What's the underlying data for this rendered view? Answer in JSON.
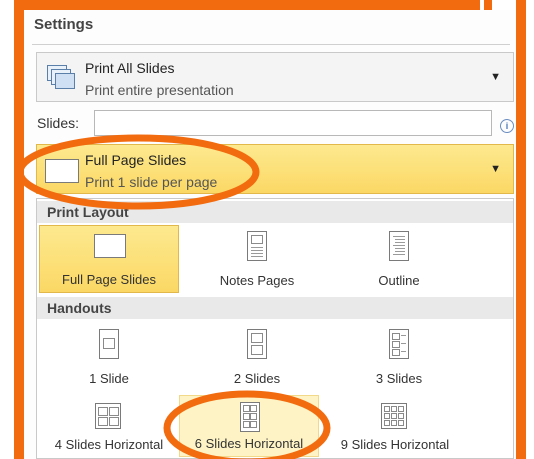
{
  "settings": {
    "title": "Settings"
  },
  "print_range": {
    "title": "Print All Slides",
    "subtitle": "Print entire presentation",
    "icon": "slides-stack-icon"
  },
  "slides_field": {
    "label": "Slides:",
    "value": "",
    "info_glyph": "i"
  },
  "layout_dropdown": {
    "title": "Full Page Slides",
    "subtitle": "Print 1 slide per page",
    "icon": "full-page-slide-icon"
  },
  "gallery": {
    "print_layout_header": "Print Layout",
    "handouts_header": "Handouts",
    "print_layout_items": [
      {
        "label": "Full Page Slides",
        "icon": "full-page-slide-icon",
        "selected": true
      },
      {
        "label": "Notes Pages",
        "icon": "notes-pages-icon",
        "selected": false
      },
      {
        "label": "Outline",
        "icon": "outline-icon",
        "selected": false
      }
    ],
    "handout_items": [
      {
        "label": "1 Slide",
        "icon": "handout-1-slide-icon"
      },
      {
        "label": "2 Slides",
        "icon": "handout-2-slides-icon"
      },
      {
        "label": "3 Slides",
        "icon": "handout-3-slides-icon"
      },
      {
        "label": "4 Slides Horizontal",
        "icon": "handout-4-slides-horizontal-icon"
      },
      {
        "label": "6 Slides Horizontal",
        "icon": "handout-6-slides-horizontal-icon",
        "hovered": true
      },
      {
        "label": "9 Slides Horizontal",
        "icon": "handout-9-slides-horizontal-icon"
      }
    ]
  },
  "colors": {
    "annotation_orange": "#f26b0f",
    "selection_yellow": "#fbd865",
    "hover_yellow": "#fdf3c5"
  }
}
